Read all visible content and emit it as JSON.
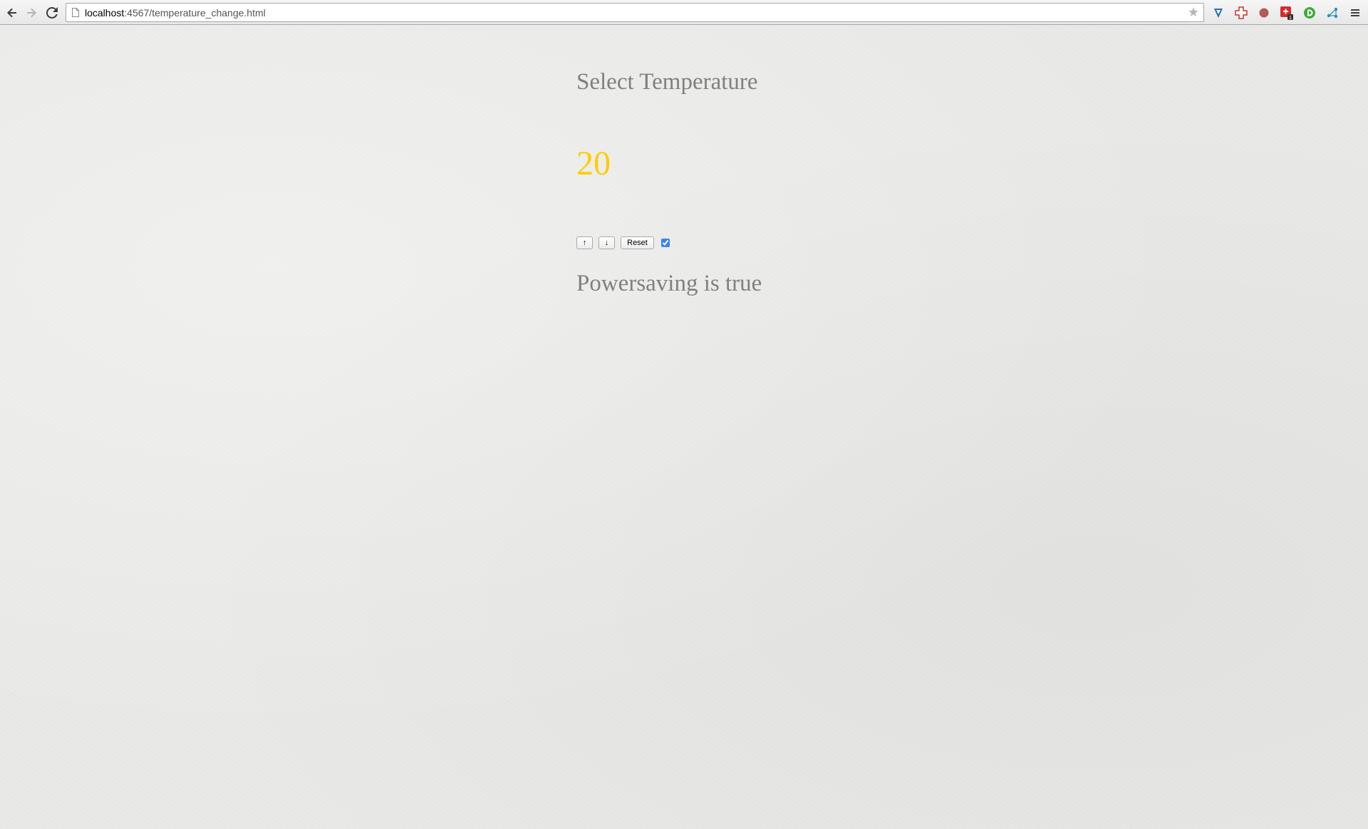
{
  "browser": {
    "url_host": "localhost",
    "url_path": ":4567/temperature_change.html",
    "icons": {
      "back": "back-arrow-icon",
      "forward": "forward-arrow-icon",
      "reload": "reload-icon",
      "page": "page-icon",
      "bookmark": "bookmark-star-icon",
      "menu": "menu-icon"
    },
    "extensions": [
      {
        "name": "v-shield-extension-icon",
        "color": "#1f6fb5"
      },
      {
        "name": "red-cross-extension-icon",
        "color": "#c0392b"
      },
      {
        "name": "red-circle-extension-icon",
        "color": "#b35a5a"
      },
      {
        "name": "red-puzzle-extension-icon",
        "color": "#d62c2c",
        "badge": "1"
      },
      {
        "name": "green-d-extension-icon",
        "color": "#3bab3b"
      },
      {
        "name": "network-extension-icon",
        "color": "#2a8fbf"
      }
    ]
  },
  "page": {
    "heading": "Select Temperature",
    "temperature": "20",
    "temperature_color": "#ffcc00",
    "up_button_label": "↑",
    "down_button_label": "↓",
    "reset_button_label": "Reset",
    "powersaving_checked": true,
    "status_text": "Powersaving is true"
  }
}
